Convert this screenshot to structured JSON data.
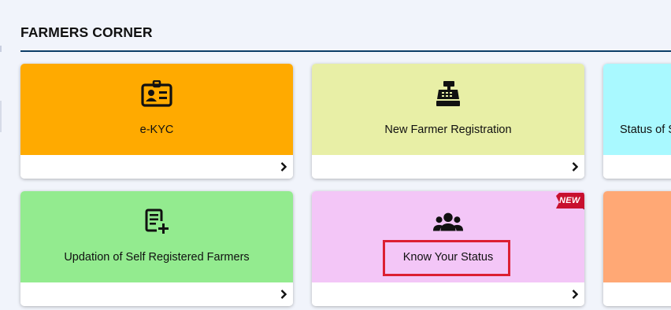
{
  "section": {
    "title": "FARMERS CORNER"
  },
  "cards": [
    {
      "label": "e-KYC",
      "color": "#ffaa00",
      "icon": "id-card-icon"
    },
    {
      "label": "New Farmer Registration",
      "color": "#e8efa6",
      "icon": "cash-register-icon"
    },
    {
      "label": "Status of S",
      "color": "#a9f9ff",
      "icon": "status-icon"
    },
    {
      "label": "Updation of Self Registered Farmers",
      "color": "#93eb8f",
      "icon": "edit-document-icon"
    },
    {
      "label": "Know Your Status",
      "color": "#f3c6f7",
      "icon": "users-icon",
      "badge": "NEW"
    },
    {
      "label": "",
      "color": "#ffa875",
      "icon": ""
    }
  ],
  "colors": {
    "background": "#f1f4fb",
    "rule": "#0c3d67",
    "highlight": "#dc1f32",
    "badge": "#c8102e"
  }
}
